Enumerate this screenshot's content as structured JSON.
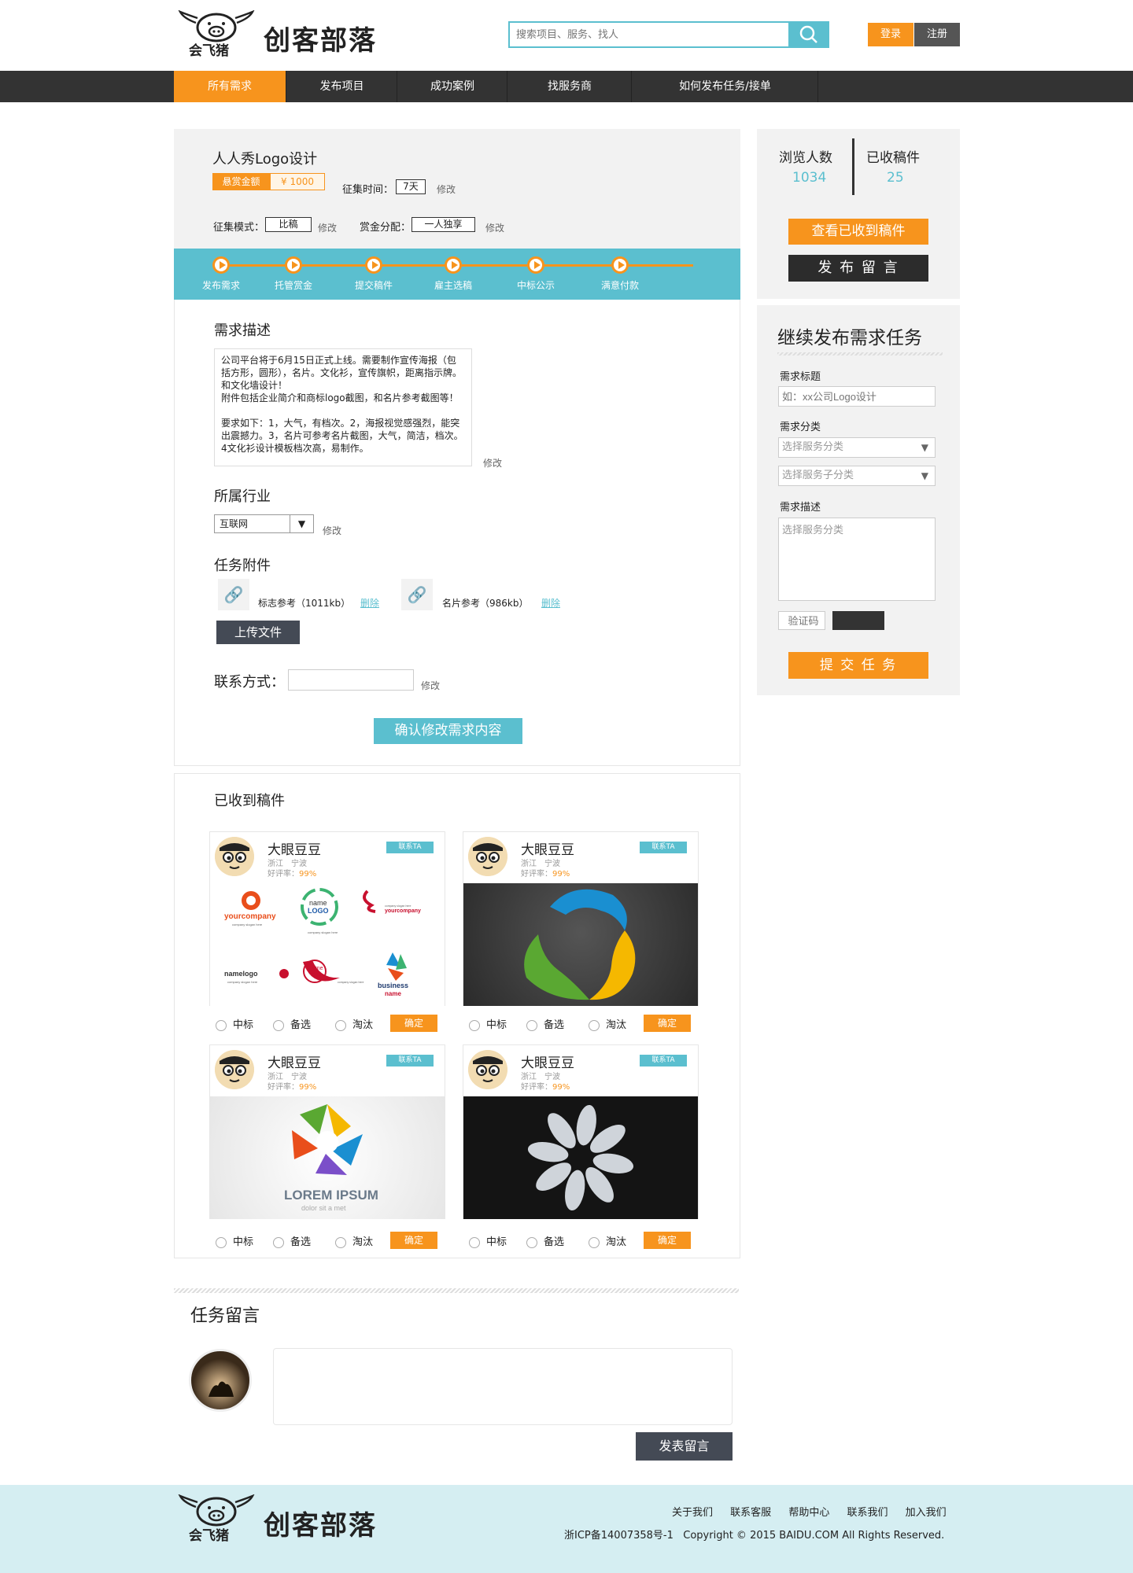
{
  "header": {
    "logo_sub": "会飞猪",
    "logo_text": "创客部落",
    "search_placeholder": "搜索项目、服务、找人",
    "login": "登录",
    "register": "注册"
  },
  "nav": {
    "items": [
      "所有需求",
      "发布项目",
      "成功案例",
      "找服务商",
      "如何发布任务/接单"
    ]
  },
  "task": {
    "title": "人人秀Logo设计",
    "reward_label": "悬赏金额",
    "reward_value": "¥ 1000",
    "collect_time_label": "征集时间：",
    "collect_time_value": "7天",
    "modify": "修改",
    "collect_mode_label": "征集模式：",
    "collect_mode_value": "比稿",
    "allot_label": "赏金分配：",
    "allot_value": "一人独享"
  },
  "steps": [
    "发布需求",
    "托管赏金",
    "提交稿件",
    "雇主选稿",
    "中标公示",
    "满意付款"
  ],
  "detail": {
    "desc_title": "需求描述",
    "desc_text": "公司平台将于6月15日正式上线。需要制作宣传海报（包括方形，圆形），名片。文化衫，宣传旗帜，距离指示牌。和文化墙设计！\n附件包括企业简介和商标logo截图，和名片参考截图等！\n\n要求如下：1，大气，有档次。2，海报视觉感强烈，能突出震撼力。3，名片可参考名片截图，大气，简洁，档次。4文化衫设计模板档次高，易制作。",
    "industry_title": "所属行业",
    "industry_value": "互联网",
    "attach_title": "任务附件",
    "attachments": [
      {
        "name": "标志参考（1011kb）",
        "delete": "删除"
      },
      {
        "name": "名片参考（986kb）",
        "delete": "删除"
      }
    ],
    "upload": "上传文件",
    "contact_label": "联系方式：",
    "confirm": "确认修改需求内容"
  },
  "received": {
    "title": "已收到稿件",
    "cards": [
      {
        "name": "大眼豆豆",
        "loc": "浙江　宁波",
        "rate_label": "好评率：",
        "rate": "99%",
        "contact": "联系TA"
      },
      {
        "name": "大眼豆豆",
        "loc": "浙江　宁波",
        "rate_label": "好评率：",
        "rate": "99%",
        "contact": "联系TA"
      },
      {
        "name": "大眼豆豆",
        "loc": "浙江　宁波",
        "rate_label": "好评率：",
        "rate": "99%",
        "contact": "联系TA"
      },
      {
        "name": "大眼豆豆",
        "loc": "浙江　宁波",
        "rate_label": "好评率：",
        "rate": "99%",
        "contact": "联系TA"
      }
    ],
    "opt_win": "中标",
    "opt_backup": "备选",
    "opt_out": "淘汰",
    "opt_ok": "确定",
    "sample1": {
      "a": "yourcompany",
      "a2": "company slogan here",
      "b": "name",
      "b2": "LOGO",
      "b3": "company slogan here",
      "c": "yourcompany",
      "c2": "company slogan here",
      "d": "namelogo",
      "d2": "company slogan here",
      "e": "name",
      "e2": "logo",
      "e3": "company slogan here",
      "f": "business",
      "f2": "name"
    },
    "sample3": {
      "a": "LOREM IPSUM",
      "b": "dolor sit a met"
    }
  },
  "comments": {
    "title": "任务留言",
    "submit": "发表留言"
  },
  "sidebar": {
    "views_label": "浏览人数",
    "views": "1034",
    "received_label": "已收稿件",
    "received": "25",
    "view_btn": "查看已收到稿件",
    "post_btn": "发 布 留 言",
    "form_title": "继续发布需求任务",
    "title_label": "需求标题",
    "title_placeholder": "如：xx公司Logo设计",
    "cat_label": "需求分类",
    "cat_select": "选择服务分类",
    "subcat_select": "选择服务子分类",
    "desc_label": "需求描述",
    "desc_placeholder": "选择服务分类",
    "captcha_placeholder": "验证码",
    "submit": "提 交 任 务"
  },
  "footer": {
    "links": [
      "关于我们",
      "联系客服",
      "帮助中心",
      "联系我们",
      "加入我们"
    ],
    "copyright": "浙ICP备14007358号-1   Copyright © 2015 BAIDU.COM All Rights Reserved.",
    "logo_sub": "会飞猪",
    "logo_text": "创客部落"
  },
  "colors": {
    "accent": "#f7941d",
    "teal": "#5bbfcf",
    "dark": "#333333"
  }
}
